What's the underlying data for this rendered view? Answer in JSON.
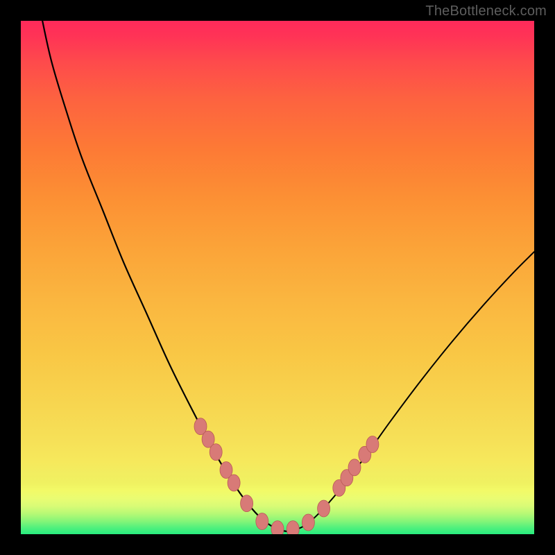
{
  "watermark": "TheBottleneck.com",
  "colors": {
    "frame": "#000000",
    "curve": "#000000",
    "marker_fill": "#d87a77",
    "marker_stroke": "#b95a56"
  },
  "chart_data": {
    "type": "line",
    "title": "",
    "xlabel": "",
    "ylabel": "",
    "xlim": [
      0,
      100
    ],
    "ylim": [
      0,
      100
    ],
    "grid": false,
    "legend": false,
    "annotations": [
      "TheBottleneck.com"
    ],
    "series": [
      {
        "name": "left-curve",
        "x": [
          4.0,
          6.0,
          9.0,
          12.0,
          16.0,
          20.0,
          24.5,
          29.0,
          33.5,
          38.0,
          42.0,
          45.0,
          47.5,
          50.0,
          52.0
        ],
        "values": [
          101.0,
          92.0,
          82.0,
          73.0,
          63.0,
          53.0,
          43.0,
          33.0,
          24.0,
          15.5,
          9.0,
          5.0,
          2.5,
          1.0,
          0.5
        ]
      },
      {
        "name": "right-curve",
        "x": [
          52.0,
          55.0,
          58.0,
          62.0,
          67.0,
          72.0,
          78.0,
          84.0,
          90.0,
          96.0,
          100.0
        ],
        "values": [
          0.5,
          1.5,
          4.0,
          8.5,
          15.0,
          22.0,
          30.0,
          37.5,
          44.5,
          51.0,
          55.0
        ]
      }
    ],
    "markers": {
      "name": "highlight-dots",
      "x": [
        35.0,
        36.5,
        38.0,
        40.0,
        41.5,
        44.0,
        47.0,
        50.0,
        53.0,
        56.0,
        59.0,
        62.0,
        63.5,
        65.0,
        67.0,
        68.5
      ],
      "values": [
        21.0,
        18.5,
        16.0,
        12.5,
        10.0,
        6.0,
        2.5,
        1.0,
        1.0,
        2.3,
        5.0,
        9.0,
        11.0,
        13.0,
        15.5,
        17.5
      ]
    }
  }
}
